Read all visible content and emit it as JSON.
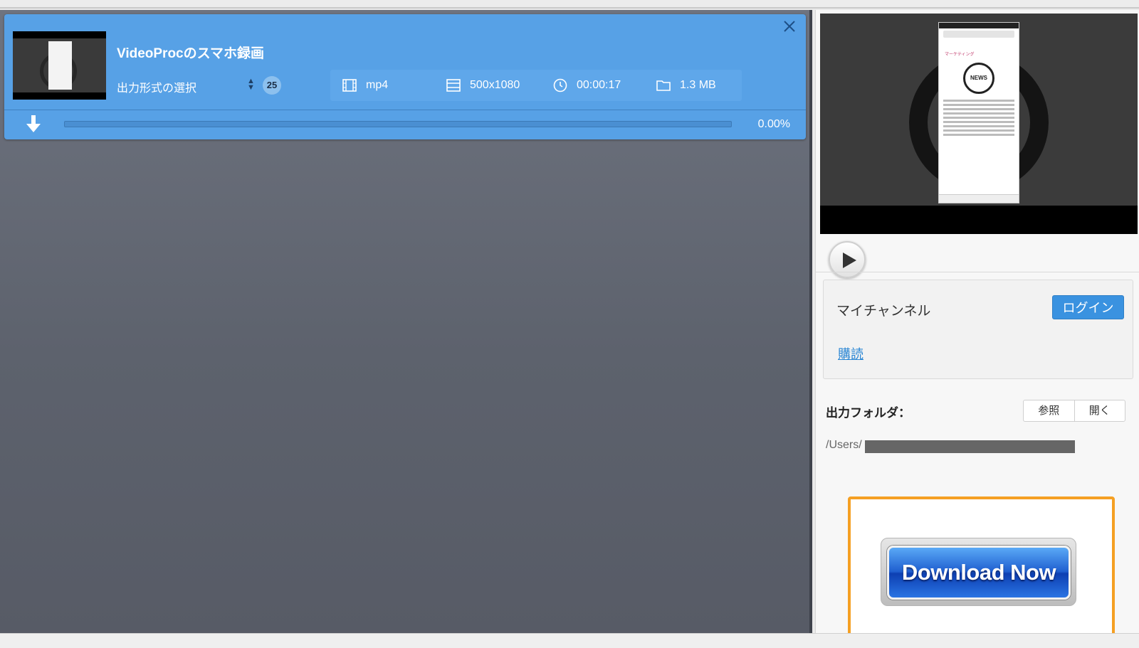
{
  "task": {
    "title": "VideoProcのスマホ録画",
    "format_label": "出力形式の選択",
    "format_count": "25",
    "info": {
      "format": "mp4",
      "resolution": "500x1080",
      "duration": "00:00:17",
      "size": "1.3 MB"
    },
    "progress_text": "0.00%",
    "progress_value": 0
  },
  "preview": {
    "phone_category": "マーケティング",
    "phone_badge": "NEWS"
  },
  "channel": {
    "title": "マイチャンネル",
    "login_label": "ログイン",
    "subscribe_label": "購読"
  },
  "output": {
    "label": "出力フォルダ：",
    "browse_label": "参照",
    "open_label": "開く",
    "path_prefix": "/Users/"
  },
  "ad": {
    "button_label": "Download Now",
    "frame_color": "#f5a023"
  },
  "colors": {
    "task_accent": "#57a1e6",
    "login_blue": "#3a92e0"
  }
}
